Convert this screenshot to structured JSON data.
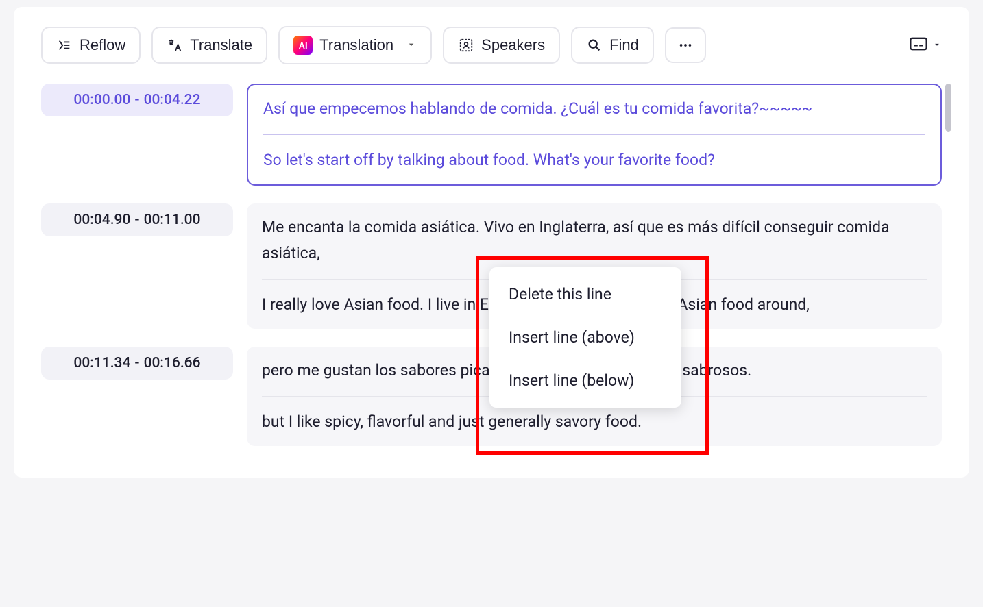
{
  "toolbar": {
    "reflow": "Reflow",
    "translate": "Translate",
    "translation": "Translation",
    "speakers": "Speakers",
    "find": "Find",
    "ai_label": "AI"
  },
  "rows": [
    {
      "ts_start": "00:00.00",
      "ts_end": "00:04.22",
      "active": true,
      "source": "Así que empecemos hablando de comida. ¿Cuál es tu comida favorita?~~~~~",
      "translation": "So let's start off by talking about food. What's your favorite food?"
    },
    {
      "ts_start": "00:04.90",
      "ts_end": "00:11.00",
      "active": false,
      "source": "Me encanta la comida asiática. Vivo en Inglaterra, así que es más difícil conseguir comida asiática,",
      "translation": "I really love Asian food. I live in England so it's harder to get Asian food around,"
    },
    {
      "ts_start": "00:11.34",
      "ts_end": "00:16.66",
      "active": false,
      "source": "pero me gustan los sabores picantes, intensos y en general, sabrosos.",
      "translation": "but I like spicy, flavorful and just generally savory food."
    }
  ],
  "context_menu": {
    "delete": "Delete this line",
    "insert_above": "Insert line (above)",
    "insert_below": "Insert line (below)"
  }
}
